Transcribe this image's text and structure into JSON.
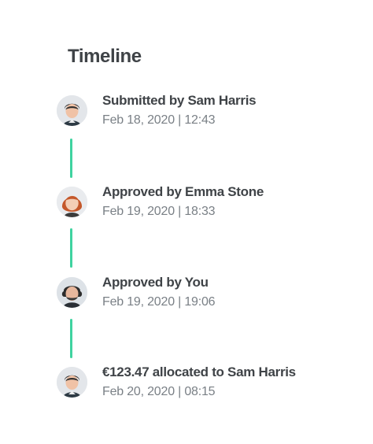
{
  "timeline": {
    "title": "Timeline",
    "accent_color": "#3fd3a0",
    "events": [
      {
        "label": "Submitted by Sam Harris",
        "time": "Feb 18, 2020 | 12:43",
        "avatar": "sam-harris-avatar"
      },
      {
        "label": "Approved by Emma Stone",
        "time": "Feb 19, 2020 | 18:33",
        "avatar": "emma-stone-avatar"
      },
      {
        "label": "Approved by You",
        "time": "Feb 19, 2020 | 19:06",
        "avatar": "you-avatar"
      },
      {
        "label": "€123.47 allocated to Sam Harris",
        "time": "Feb 20, 2020 | 08:15",
        "avatar": "sam-harris-avatar"
      }
    ]
  }
}
